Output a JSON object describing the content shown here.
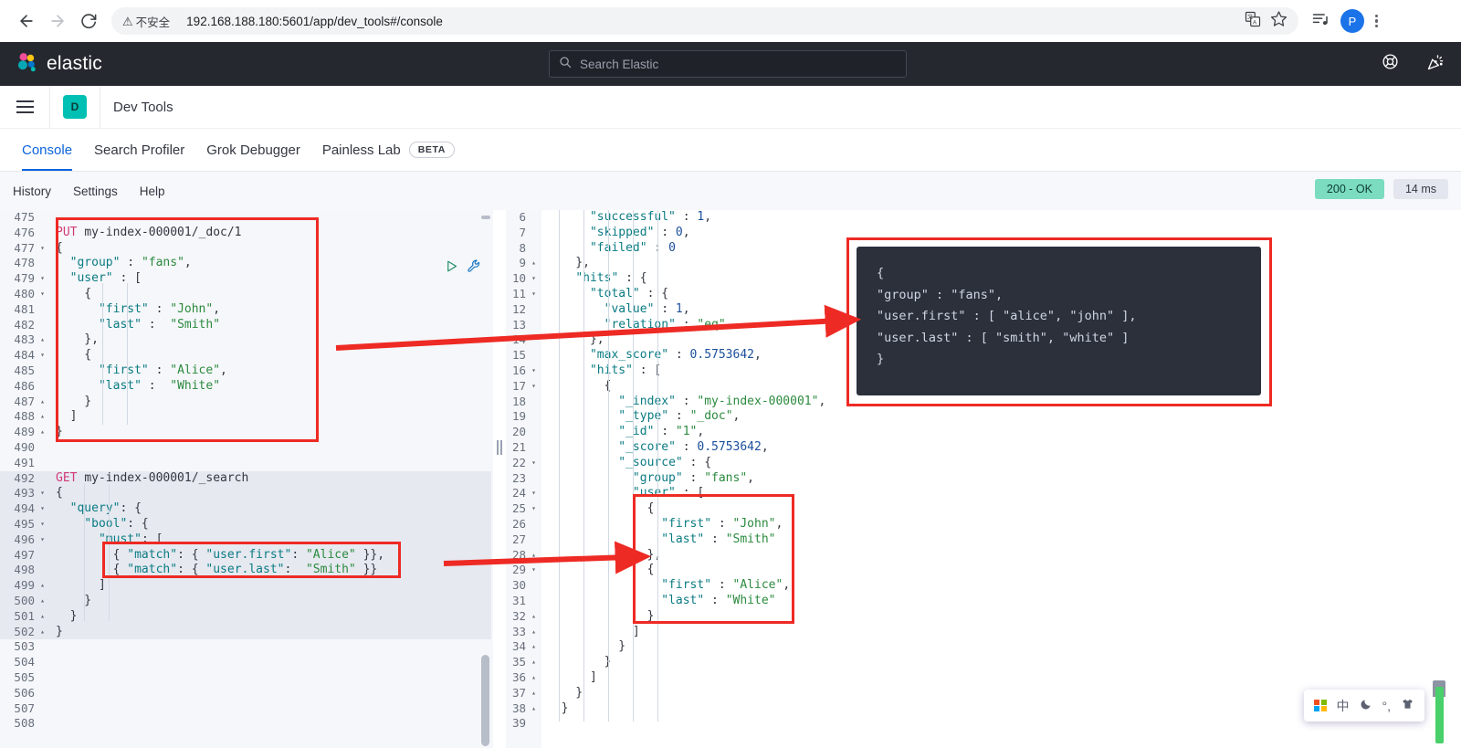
{
  "browser": {
    "back_icon": "back-arrow-icon",
    "forward_icon": "forward-arrow-icon",
    "reload_icon": "reload-icon",
    "security_label": "不安全",
    "url": "192.168.188.180:5601/app/dev_tools#/console",
    "translate_icon": "translate-icon",
    "bookmark_icon": "star-icon",
    "reading_list_icon": "reading-list-icon",
    "profile_initial": "P",
    "menu_icon": "three-dot-menu-icon"
  },
  "elastic_header": {
    "brand": "elastic",
    "logo_icon": "elastic-logo-icon",
    "search_placeholder": "Search Elastic",
    "search_icon": "search-icon",
    "help_icon": "help-lifebuoy-icon",
    "announcement_icon": "party-popper-icon"
  },
  "app_nav": {
    "menu_icon": "hamburger-menu-icon",
    "app_badge": "D",
    "app_title": "Dev Tools"
  },
  "tabs": [
    {
      "label": "Console",
      "active": true,
      "badge": ""
    },
    {
      "label": "Search Profiler",
      "active": false,
      "badge": ""
    },
    {
      "label": "Grok Debugger",
      "active": false,
      "badge": ""
    },
    {
      "label": "Painless Lab",
      "active": false,
      "badge": "BETA"
    }
  ],
  "console_toolbar": {
    "links": [
      "History",
      "Settings",
      "Help"
    ],
    "status_code": "200 - OK",
    "status_color": "#7bdcc0",
    "duration": "14 ms"
  },
  "editor": {
    "run_icon": "play-run-icon",
    "wrench_icon": "wrench-icon",
    "splitter_icon": "pane-splitter-handle",
    "lines": [
      {
        "n": "475",
        "fold": "",
        "text": "",
        "hl": false
      },
      {
        "n": "476",
        "fold": "",
        "text": "PUT my-index-000001/_doc/1",
        "hl": false
      },
      {
        "n": "477",
        "fold": "▾",
        "text": "{",
        "hl": false
      },
      {
        "n": "478",
        "fold": "",
        "text": "  \"group\" : \"fans\",",
        "hl": false
      },
      {
        "n": "479",
        "fold": "▾",
        "text": "  \"user\" : [",
        "hl": false
      },
      {
        "n": "480",
        "fold": "▾",
        "text": "    {",
        "hl": false
      },
      {
        "n": "481",
        "fold": "",
        "text": "      \"first\" : \"John\",",
        "hl": false
      },
      {
        "n": "482",
        "fold": "",
        "text": "      \"last\" :  \"Smith\"",
        "hl": false
      },
      {
        "n": "483",
        "fold": "▴",
        "text": "    },",
        "hl": false
      },
      {
        "n": "484",
        "fold": "▾",
        "text": "    {",
        "hl": false
      },
      {
        "n": "485",
        "fold": "",
        "text": "      \"first\" : \"Alice\",",
        "hl": false
      },
      {
        "n": "486",
        "fold": "",
        "text": "      \"last\" :  \"White\"",
        "hl": false
      },
      {
        "n": "487",
        "fold": "▴",
        "text": "    }",
        "hl": false
      },
      {
        "n": "488",
        "fold": "▴",
        "text": "  ]",
        "hl": false
      },
      {
        "n": "489",
        "fold": "▴",
        "text": "}",
        "hl": false
      },
      {
        "n": "490",
        "fold": "",
        "text": "",
        "hl": false
      },
      {
        "n": "491",
        "fold": "",
        "text": "",
        "hl": false
      },
      {
        "n": "492",
        "fold": "",
        "text": "GET my-index-000001/_search",
        "hl": true
      },
      {
        "n": "493",
        "fold": "▾",
        "text": "{",
        "hl": true
      },
      {
        "n": "494",
        "fold": "▾",
        "text": "  \"query\": {",
        "hl": true
      },
      {
        "n": "495",
        "fold": "▾",
        "text": "    \"bool\": {",
        "hl": true
      },
      {
        "n": "496",
        "fold": "▾",
        "text": "      \"must\": [",
        "hl": true
      },
      {
        "n": "497",
        "fold": "",
        "text": "        { \"match\": { \"user.first\": \"Alice\" }},",
        "hl": true
      },
      {
        "n": "498",
        "fold": "",
        "text": "        { \"match\": { \"user.last\":  \"Smith\" }}",
        "hl": true
      },
      {
        "n": "499",
        "fold": "▴",
        "text": "      ]",
        "hl": true
      },
      {
        "n": "500",
        "fold": "▴",
        "text": "    }",
        "hl": true
      },
      {
        "n": "501",
        "fold": "▴",
        "text": "  }",
        "hl": true
      },
      {
        "n": "502",
        "fold": "▴",
        "text": "}",
        "hl": true
      },
      {
        "n": "503",
        "fold": "",
        "text": "",
        "hl": false
      },
      {
        "n": "504",
        "fold": "",
        "text": "",
        "hl": false
      },
      {
        "n": "505",
        "fold": "",
        "text": "",
        "hl": false
      },
      {
        "n": "506",
        "fold": "",
        "text": "",
        "hl": false
      },
      {
        "n": "507",
        "fold": "",
        "text": "",
        "hl": false
      },
      {
        "n": "508",
        "fold": "",
        "text": "",
        "hl": false
      }
    ]
  },
  "response": {
    "lines": [
      {
        "n": "6",
        "fold": "",
        "text": "      \"successful\" : 1,"
      },
      {
        "n": "7",
        "fold": "",
        "text": "      \"skipped\" : 0,"
      },
      {
        "n": "8",
        "fold": "",
        "text": "      \"failed\" : 0"
      },
      {
        "n": "9",
        "fold": "▴",
        "text": "    },"
      },
      {
        "n": "10",
        "fold": "▾",
        "text": "    \"hits\" : {"
      },
      {
        "n": "11",
        "fold": "▾",
        "text": "      \"total\" : {"
      },
      {
        "n": "12",
        "fold": "",
        "text": "        \"value\" : 1,"
      },
      {
        "n": "13",
        "fold": "",
        "text": "        \"relation\" : \"eq\""
      },
      {
        "n": "14",
        "fold": "",
        "text": "      },"
      },
      {
        "n": "15",
        "fold": "",
        "text": "      \"max_score\" : 0.5753642,"
      },
      {
        "n": "16",
        "fold": "▾",
        "text": "      \"hits\" : ["
      },
      {
        "n": "17",
        "fold": "▾",
        "text": "        {"
      },
      {
        "n": "18",
        "fold": "",
        "text": "          \"_index\" : \"my-index-000001\","
      },
      {
        "n": "19",
        "fold": "",
        "text": "          \"_type\" : \"_doc\","
      },
      {
        "n": "20",
        "fold": "",
        "text": "          \"_id\" : \"1\","
      },
      {
        "n": "21",
        "fold": "",
        "text": "          \"_score\" : 0.5753642,"
      },
      {
        "n": "22",
        "fold": "▾",
        "text": "          \"_source\" : {"
      },
      {
        "n": "23",
        "fold": "",
        "text": "            \"group\" : \"fans\","
      },
      {
        "n": "24",
        "fold": "▾",
        "text": "            \"user\" : ["
      },
      {
        "n": "25",
        "fold": "▾",
        "text": "              {"
      },
      {
        "n": "26",
        "fold": "",
        "text": "                \"first\" : \"John\","
      },
      {
        "n": "27",
        "fold": "",
        "text": "                \"last\" : \"Smith\""
      },
      {
        "n": "28",
        "fold": "▴",
        "text": "              },"
      },
      {
        "n": "29",
        "fold": "▾",
        "text": "              {"
      },
      {
        "n": "30",
        "fold": "",
        "text": "                \"first\" : \"Alice\","
      },
      {
        "n": "31",
        "fold": "",
        "text": "                \"last\" : \"White\""
      },
      {
        "n": "32",
        "fold": "▴",
        "text": "              }"
      },
      {
        "n": "33",
        "fold": "▴",
        "text": "            ]"
      },
      {
        "n": "34",
        "fold": "▴",
        "text": "          }"
      },
      {
        "n": "35",
        "fold": "▴",
        "text": "        }"
      },
      {
        "n": "36",
        "fold": "▴",
        "text": "      ]"
      },
      {
        "n": "37",
        "fold": "▴",
        "text": "    }"
      },
      {
        "n": "38",
        "fold": "▴",
        "text": "  }"
      },
      {
        "n": "39",
        "fold": "",
        "text": ""
      }
    ]
  },
  "annotation_card": {
    "lines": [
      "{",
      "    \"group\" :        \"fans\",",
      "    \"user.first\" : [ \"alice\", \"john\" ],",
      "    \"user.last\" :  [ \"smith\", \"white\" ]",
      "}"
    ],
    "border_color": "#ee2a24",
    "background_color": "#2b303b"
  },
  "ime_bar": {
    "windows_icon": "windows-logo-icon",
    "mode": "中",
    "shape_icon": "moon-halfwidth-icon",
    "punctuation": "°,",
    "skin_icon": "skin-shirt-icon"
  }
}
